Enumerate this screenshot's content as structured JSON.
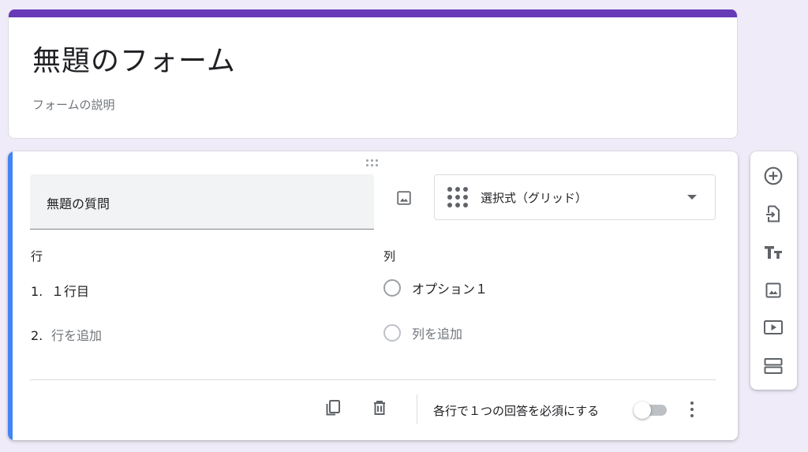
{
  "form": {
    "title": "無題のフォーム",
    "description": "フォームの説明"
  },
  "question": {
    "title": "無題の質問",
    "type_label": "選択式（グリッド）",
    "rows_header": "行",
    "columns_header": "列",
    "rows": [
      {
        "num": "1.",
        "text": "１行目"
      },
      {
        "num": "2.",
        "text": "行を追加"
      }
    ],
    "columns": [
      {
        "text": "オプション１"
      },
      {
        "text": "列を追加"
      }
    ],
    "required_label": "各行で１つの回答を必須にする",
    "required_on": false
  },
  "icons": {
    "drag": "drag-handle-icon",
    "image": "image-icon",
    "grid": "grid-dots-icon",
    "copy": "copy-icon",
    "delete": "delete-icon",
    "more": "more-vert-icon",
    "add": "add-circle-icon",
    "import": "import-question-icon",
    "title": "title-text-icon",
    "add_image": "add-image-icon",
    "video": "video-icon",
    "section": "section-icon"
  },
  "colors": {
    "brand": "#673ab7",
    "accent": "#4285f4",
    "background": "#f0ebf8"
  }
}
